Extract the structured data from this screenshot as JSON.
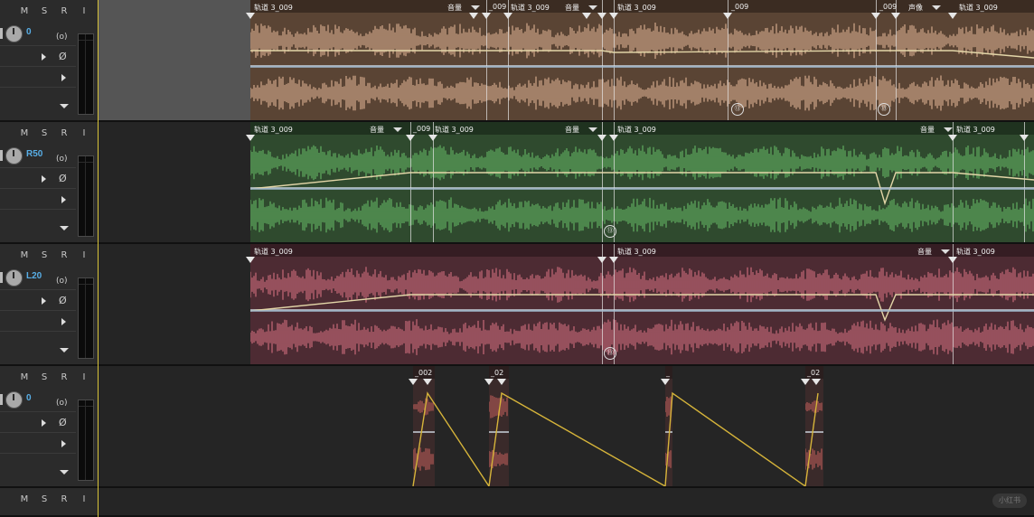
{
  "tracks": [
    {
      "buttons": [
        "M",
        "S",
        "R",
        "I"
      ],
      "pan": "0",
      "clip_label": "轨道 3_009",
      "colors": {
        "clip": "#5a4434",
        "wave": "#c19a7e",
        "dark": "#3b2c22"
      },
      "labels": [
        {
          "text": "轨道 3_009"
        },
        {
          "text": "音量"
        },
        {
          "text": "_009"
        },
        {
          "text": "轨道 3_009"
        },
        {
          "text": "音量"
        },
        {
          "text": "轨道 3_009"
        },
        {
          "text": "_009"
        },
        {
          "text": "_009"
        },
        {
          "text": "声像"
        },
        {
          "text": "轨道 3_009"
        }
      ],
      "badges": [
        "⑬",
        "⑬"
      ]
    },
    {
      "buttons": [
        "M",
        "S",
        "R",
        "I"
      ],
      "pan": "R50",
      "colors": {
        "clip": "#2f4a2e",
        "wave": "#5aa05a",
        "dark": "#1f321f"
      },
      "labels": [
        {
          "text": "轨道 3_009"
        },
        {
          "text": "音量"
        },
        {
          "text": "_009"
        },
        {
          "text": "轨道 3_009"
        },
        {
          "text": "音量"
        },
        {
          "text": "轨道 3_009"
        },
        {
          "text": "音量"
        },
        {
          "text": "轨道 3_009"
        }
      ],
      "badges": [
        "⑬"
      ]
    },
    {
      "buttons": [
        "M",
        "S",
        "R",
        "I"
      ],
      "pan": "L20",
      "colors": {
        "clip": "#4d2b33",
        "wave": "#b5606f",
        "dark": "#351d23"
      },
      "labels": [
        {
          "text": "轨道 3_009"
        },
        {
          "text": "轨道 3_009"
        },
        {
          "text": "音量"
        },
        {
          "text": "轨道 3_009"
        }
      ],
      "badges": [
        "⑬"
      ]
    },
    {
      "buttons": [
        "M",
        "S",
        "R",
        "I"
      ],
      "pan": "0",
      "colors": {
        "clip": "#3a2a2a",
        "wave": "#a2524f",
        "dark": "#2a1e1e"
      },
      "labels": [
        {
          "text": "_002"
        },
        {
          "text": "_02"
        },
        {
          "text": "_"
        },
        {
          "text": "_02"
        }
      ]
    },
    {
      "buttons": [
        "M",
        "S",
        "R",
        "I"
      ]
    }
  ],
  "icons": {
    "automation": "(o)",
    "phase": "Ø",
    "expand": "▶",
    "dropdown": "▼"
  },
  "watermark": "小红书"
}
